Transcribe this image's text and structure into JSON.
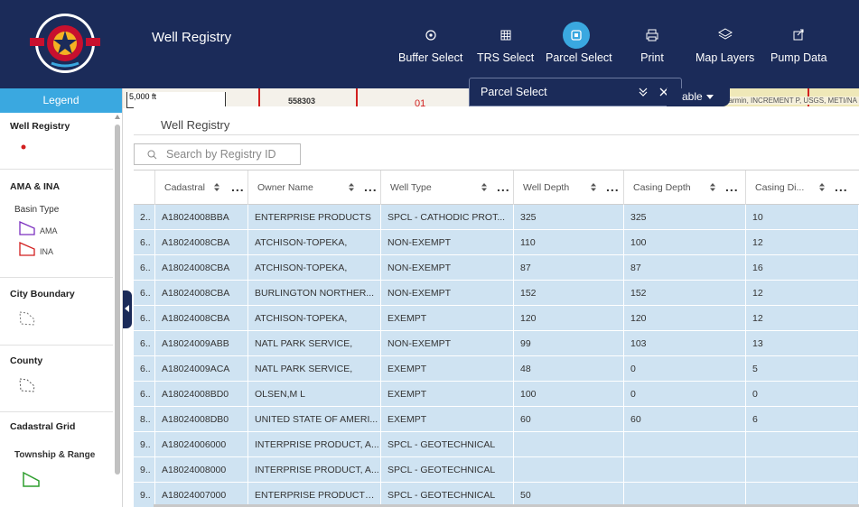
{
  "header": {
    "app_title": "Well Registry",
    "logo_text": "ARIZONA DEPARTMENT OF WATER RESOURCES",
    "tools": [
      {
        "label": "Buffer Select",
        "icon": "buffer-icon"
      },
      {
        "label": "TRS Select",
        "icon": "grid-icon"
      },
      {
        "label": "Parcel Select",
        "icon": "parcel-icon",
        "active": true
      },
      {
        "label": "Print",
        "icon": "printer-icon"
      },
      {
        "label": "Map Layers",
        "icon": "layers-icon"
      },
      {
        "label": "Pump Data",
        "icon": "export-icon"
      }
    ]
  },
  "legend": {
    "tab_label": "Legend",
    "sections": {
      "well_registry": "Well Registry",
      "ama_ina": "AMA & INA",
      "basin_type": "Basin Type",
      "ama": "AMA",
      "ina": "INA",
      "city_boundary": "City Boundary",
      "county": "County",
      "cadastral_grid": "Cadastral Grid",
      "township_range": "Township & Range"
    }
  },
  "map": {
    "scale": "5,000 ft",
    "parcel_label": "558303",
    "red_label": "01",
    "attribution": "armin, INCREMENT P, USGS, METI/NA"
  },
  "popup": {
    "title": "Parcel Select",
    "table_tab": "able"
  },
  "table": {
    "title": "Well Registry",
    "search_placeholder": "Search by Registry ID",
    "columns": [
      "Cadastral",
      "Owner Name",
      "Well Type",
      "Well Depth",
      "Casing Depth",
      "Casing Di..."
    ],
    "rows": [
      {
        "id": "2..",
        "cadastral": "A18024008BBA",
        "owner": "ENTERPRISE PRODUCTS",
        "type": "SPCL - CATHODIC PROT...",
        "depth": "325",
        "casing_depth": "325",
        "casing_dia": "10"
      },
      {
        "id": "6..",
        "cadastral": "A18024008CBA",
        "owner": "ATCHISON-TOPEKA,",
        "type": "NON-EXEMPT",
        "depth": "110",
        "casing_depth": "100",
        "casing_dia": "12"
      },
      {
        "id": "6..",
        "cadastral": "A18024008CBA",
        "owner": "ATCHISON-TOPEKA,",
        "type": "NON-EXEMPT",
        "depth": "87",
        "casing_depth": "87",
        "casing_dia": "16"
      },
      {
        "id": "6..",
        "cadastral": "A18024008CBA",
        "owner": "BURLINGTON NORTHER...",
        "type": "NON-EXEMPT",
        "depth": "152",
        "casing_depth": "152",
        "casing_dia": "12"
      },
      {
        "id": "6..",
        "cadastral": "A18024008CBA",
        "owner": "ATCHISON-TOPEKA,",
        "type": "EXEMPT",
        "depth": "120",
        "casing_depth": "120",
        "casing_dia": "12"
      },
      {
        "id": "6..",
        "cadastral": "A18024009ABB",
        "owner": "NATL PARK SERVICE,",
        "type": "NON-EXEMPT",
        "depth": "99",
        "casing_depth": "103",
        "casing_dia": "13"
      },
      {
        "id": "6..",
        "cadastral": "A18024009ACA",
        "owner": "NATL PARK SERVICE,",
        "type": "EXEMPT",
        "depth": "48",
        "casing_depth": "0",
        "casing_dia": "5"
      },
      {
        "id": "6..",
        "cadastral": "A18024008BD0",
        "owner": "OLSEN,M L",
        "type": "EXEMPT",
        "depth": "100",
        "casing_depth": "0",
        "casing_dia": "0"
      },
      {
        "id": "8..",
        "cadastral": "A18024008DB0",
        "owner": "UNITED STATE OF AMERI...",
        "type": "EXEMPT",
        "depth": "60",
        "casing_depth": "60",
        "casing_dia": "6"
      },
      {
        "id": "9..",
        "cadastral": "A18024006000",
        "owner": "INTERPRISE PRODUCT, A...",
        "type": "SPCL - GEOTECHNICAL",
        "depth": "",
        "casing_depth": "",
        "casing_dia": ""
      },
      {
        "id": "9..",
        "cadastral": "A18024008000",
        "owner": "INTERPRISE PRODUCT, A...",
        "type": "SPCL - GEOTECHNICAL",
        "depth": "",
        "casing_depth": "",
        "casing_dia": ""
      },
      {
        "id": "9..",
        "cadastral": "A18024007000",
        "owner": "ENTERPRISE PRODUCTS ...",
        "type": "SPCL - GEOTECHNICAL",
        "depth": "50",
        "casing_depth": "",
        "casing_dia": ""
      }
    ]
  },
  "colors": {
    "header_bg": "#1b2b59",
    "accent": "#3aa8e0",
    "row_bg": "#cfe3f2",
    "well_point": "#d21f1f",
    "ama": "#7b2fbf",
    "ina": "#d21f1f",
    "township": "#2e9e2e"
  }
}
